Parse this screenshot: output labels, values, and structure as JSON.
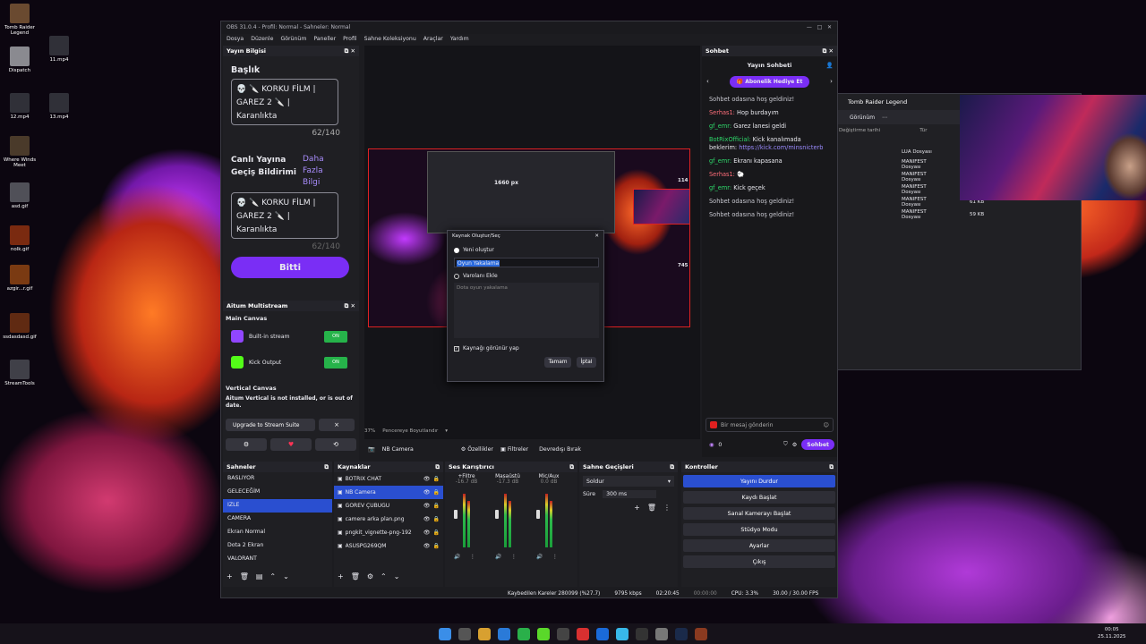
{
  "desktop": {
    "icons": [
      {
        "label": "Tomb Raider Legend",
        "color": "#6a4a30"
      },
      {
        "label": "11.mp4",
        "color": "#303038"
      },
      {
        "label": "Dispatch",
        "color": "#8a8a90"
      },
      {
        "label": "12.mp4",
        "color": "#303038"
      },
      {
        "label": "13.mp4",
        "color": "#303038"
      },
      {
        "label": "Where Winds Meet",
        "color": "#4a3a2a"
      },
      {
        "label": "asd.gif",
        "color": "#505058"
      },
      {
        "label": "nolk.gif",
        "color": "#7a2a10"
      },
      {
        "label": "azgir...r.gif",
        "color": "#7a3a12"
      },
      {
        "label": "ssdasdasd.gif",
        "color": "#602a12"
      },
      {
        "label": "StreamTools",
        "color": "#404048"
      }
    ]
  },
  "obs": {
    "title": "OBS 31.0.4 - Profil: Normal - Sahneler: Normal",
    "menu": [
      "Dosya",
      "Düzenle",
      "Görünüm",
      "Paneller",
      "Profil",
      "Sahne Koleksiyonu",
      "Araçlar",
      "Yardım"
    ],
    "stream_info": {
      "header": "Yayın Bilgisi",
      "title_label": "Başlık",
      "title_text": "💀 🔪 KORKU FİLM | GAREZ 2 🔪 | Karanlıkta",
      "title_count": "62/140",
      "notify_label": "Canlı Yayına Geçiş Bildirimi",
      "more": "Daha Fazla Bilgi",
      "notify_text": "💀 🔪 KORKU FİLM | GAREZ 2 🔪 | Karanlıkta",
      "notify_count": "62/140",
      "done": "Bitti"
    },
    "multistream": {
      "header": "Aitum Multistream",
      "main_canvas": "Main Canvas",
      "outputs": [
        {
          "name": "Built-in stream",
          "icon": "twitch-icon",
          "color": "#9146ff"
        },
        {
          "name": "Kick Output",
          "icon": "kick-icon",
          "color": "#53fc18"
        }
      ],
      "vertical_canvas": "Vertical Canvas",
      "vertical_msg": "Aitum Vertical is not installed, or is out of date.",
      "upgrade": "Upgrade to Stream Suite",
      "close": "×"
    },
    "preview": {
      "label_1660": "1660 px",
      "label_114": "114",
      "label_745": "745",
      "zoom": "37%",
      "fit": "Pencereye Boyutlandır"
    },
    "dialog": {
      "title": "Kaynak Oluştur/Seç",
      "new_label": "Yeni oluştur",
      "name_value": "Oyun Yakalama",
      "existing_label": "Varolanı Ekle",
      "existing_item": "Dota oyun yakalama",
      "visible_label": "Kaynağı görünür yap",
      "ok": "Tamam",
      "cancel": "İptal"
    },
    "source_toolbar": {
      "selected": "NB Camera",
      "props": "Özellikler",
      "filters": "Filtreler",
      "deactivate": "Devredışı Bırak"
    },
    "scenes": {
      "header": "Sahneler",
      "items": [
        "BASLIYOR",
        "GELECEĞİM",
        "IZLE",
        "CAMERA",
        "Ekran Normal",
        "Dota 2 Ekran",
        "VALORANT"
      ],
      "selected": 2
    },
    "sources": {
      "header": "Kaynaklar",
      "items": [
        "BOTRIX CHAT",
        "NB Camera",
        "GÖREV ÇUBUĞU",
        "camere arka plan.png",
        "pngkit_vignette-png-192",
        "ASUSPG269QM"
      ],
      "selected": 1
    },
    "mixer": {
      "header": "Ses Karıştırıcı",
      "channels": [
        {
          "name": "+Filtre",
          "db": "-16.7 dB"
        },
        {
          "name": "Masaüstü",
          "db": "-17.3 dB"
        },
        {
          "name": "Mic/Aux",
          "db": "0.0 dB"
        }
      ]
    },
    "transitions": {
      "header": "Sahne Geçişleri",
      "type": "Soldur",
      "duration_label": "Süre",
      "duration": "300 ms"
    },
    "controls": {
      "header": "Kontroller",
      "buttons": [
        "Yayını Durdur",
        "Kaydı Başlat",
        "Sanal Kamerayı Başlat",
        "Stüdyo Modu",
        "Ayarlar",
        "Çıkış"
      ]
    },
    "status": {
      "dropped": "Kaybedilen Kareler 280099 (%27.7)",
      "kbps": "9795 kbps",
      "live_time": "02:20:45",
      "rec_time": "00:00:00",
      "cpu": "CPU: 3.3%",
      "fps": "30.00 / 30.00 FPS"
    }
  },
  "chat": {
    "dock_title": "Sohbet",
    "header": "Yayın Sohbeti",
    "gift": "Abonelik Hediye Et",
    "messages": [
      {
        "user": "",
        "text": "Sohbet odasına hoş geldiniz!",
        "uc": "#c8c8d0"
      },
      {
        "user": "Serhas1:",
        "text": " Hop burdayım",
        "uc": "#ff6e7a"
      },
      {
        "user": "gf_emr:",
        "text": " Garez lanesi geldi",
        "uc": "#2ed86a"
      },
      {
        "user": "BotRixOfficial:",
        "text": " Kick kanalımada beklerim: ",
        "link": "https://kick.com/minsnicterb",
        "uc": "#2ed86a"
      },
      {
        "user": "gf_emr:",
        "text": " Ekranı kapasana",
        "uc": "#2ed86a"
      },
      {
        "user": "Serhas1:",
        "text": " 🐑",
        "uc": "#ff6e7a"
      },
      {
        "user": "gf_emr:",
        "text": " Kick geçek",
        "uc": "#2ed86a"
      },
      {
        "user": "",
        "text": "Sohbet odasına hoş geldiniz!",
        "uc": "#c8c8d0"
      },
      {
        "user": "",
        "text": "Sohbet odasına hoş geldiniz!",
        "uc": "#c8c8d0"
      }
    ],
    "input_placeholder": "Bir mesaj gönderin",
    "viewers": "0",
    "send": "Sohbet"
  },
  "explorer": {
    "title": "Tomb Raider Legend",
    "view": "Görünüm",
    "col_date": "Değiştirme tarihi",
    "col_type": "Tür",
    "rows": [
      {
        "type": "LUA Dosyası",
        "size": ""
      },
      {
        "type": "MANIFEST Dosyası",
        "size": ""
      },
      {
        "type": "MANIFEST Dosyası",
        "size": ""
      },
      {
        "type": "MANIFEST Dosyası",
        "size": "64 KB"
      },
      {
        "type": "MANIFEST Dosyası",
        "size": "61 KB"
      },
      {
        "type": "MANIFEST Dosyası",
        "size": "59 KB"
      }
    ]
  },
  "taskbar": {
    "time": "00:05",
    "date": "25.11.2025"
  }
}
